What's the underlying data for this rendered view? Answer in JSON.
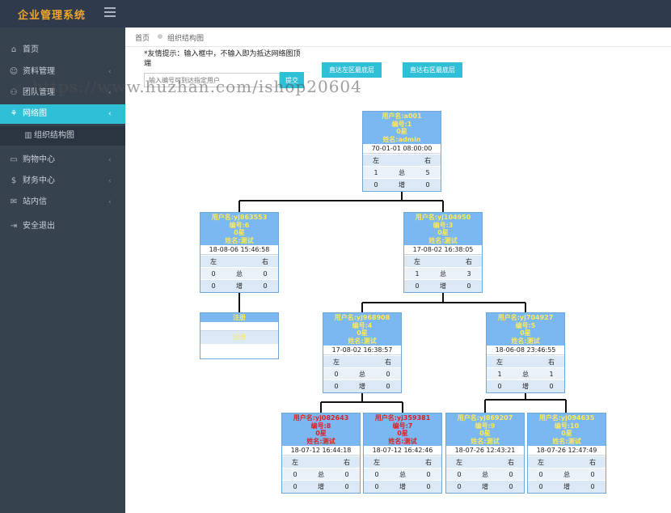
{
  "app": {
    "title": "企业管理系统"
  },
  "sidebar": {
    "items": [
      {
        "label": "首页",
        "icon": "home-icon",
        "glyph": "⌂",
        "arrow": ""
      },
      {
        "label": "资料管理",
        "icon": "user-icon",
        "glyph": "☺",
        "arrow": "‹"
      },
      {
        "label": "团队管理",
        "icon": "team-icon",
        "glyph": "⚇",
        "arrow": "‹"
      },
      {
        "label": "网络图",
        "icon": "sitemap-icon",
        "glyph": "⚘",
        "arrow": "‹"
      },
      {
        "label": "组织结构图",
        "icon": "bar-chart-icon",
        "glyph": "▥",
        "arrow": ""
      },
      {
        "label": "购物中心",
        "icon": "truck-icon",
        "glyph": "▭",
        "arrow": "‹"
      },
      {
        "label": "财务中心",
        "icon": "dollar-icon",
        "glyph": "$",
        "arrow": "‹"
      },
      {
        "label": "站内信",
        "icon": "envelope-icon",
        "glyph": "✉",
        "arrow": "‹"
      },
      {
        "label": "安全退出",
        "icon": "logout-icon",
        "glyph": "⇥",
        "arrow": ""
      }
    ]
  },
  "breadcrumb": {
    "home": "首页",
    "current": "组织结构图"
  },
  "search": {
    "tip": "*友情提示：输入框中，不输入即为抵达网络图顶端",
    "placeholder": "输入编号可到达指定用户",
    "submit_label": "提交",
    "jump_left_label": "直达左区最底层",
    "jump_right_label": "直达右区最底层"
  },
  "watermark": "https://www.huzhan.com/ishop20604",
  "tree": {
    "labels": {
      "left": "左",
      "right": "右",
      "total": "总",
      "new": "增"
    },
    "nodes": [
      {
        "id": "n0",
        "l1": "用户名:a001",
        "l2": "编号:1",
        "l3": "0星",
        "l4": "姓名:admin",
        "date": "70-01-01 08:00:00",
        "tl": "1",
        "tr": "5",
        "nl": "0",
        "nr": "0",
        "red": false
      },
      {
        "id": "n1",
        "l1": "用户名:yj863553",
        "l2": "编号:6",
        "l3": "0星",
        "l4": "姓名:测试",
        "date": "18-08-06 15:46:58",
        "tl": "0",
        "tr": "0",
        "nl": "0",
        "nr": "0",
        "red": false
      },
      {
        "id": "n2",
        "l1": "用户名:yj104950",
        "l2": "编号:3",
        "l3": "0星",
        "l4": "姓名:测试",
        "date": "17-08-02 16:38:05",
        "tl": "1",
        "tr": "3",
        "nl": "0",
        "nr": "0",
        "red": false
      },
      {
        "id": "n3",
        "l1": "用户名:yj968908",
        "l2": "编号:4",
        "l3": "0星",
        "l4": "姓名:测试",
        "date": "17-08-02 16:38:57",
        "tl": "0",
        "tr": "0",
        "nl": "0",
        "nr": "0",
        "red": false
      },
      {
        "id": "n4",
        "l1": "用户名:yj704927",
        "l2": "编号:5",
        "l3": "0星",
        "l4": "姓名:测试",
        "date": "18-06-08 23:46:55",
        "tl": "1",
        "tr": "1",
        "nl": "0",
        "nr": "0",
        "red": false
      },
      {
        "id": "n5",
        "l1": "用户名:yj082643",
        "l2": "编号:8",
        "l3": "0星",
        "l4": "姓名:测试",
        "date": "18-07-12 16:44:18",
        "tl": "0",
        "tr": "0",
        "nl": "0",
        "nr": "0",
        "red": true
      },
      {
        "id": "n6",
        "l1": "用户名:yj359381",
        "l2": "编号:7",
        "l3": "0星",
        "l4": "姓名:测试",
        "date": "18-07-12 16:42:46",
        "tl": "0",
        "tr": "0",
        "nl": "0",
        "nr": "0",
        "red": true
      },
      {
        "id": "n7",
        "l1": "用户名:yj869207",
        "l2": "编号:9",
        "l3": "0星",
        "l4": "姓名:测试",
        "date": "18-07-26 12:43:21",
        "tl": "0",
        "tr": "0",
        "nl": "0",
        "nr": "0",
        "red": false
      },
      {
        "id": "n8",
        "l1": "用户名:yj094635",
        "l2": "编号:10",
        "l3": "0星",
        "l4": "姓名:测试",
        "date": "18-07-26 12:47:49",
        "tl": "0",
        "tr": "0",
        "nl": "0",
        "nr": "0",
        "red": false
      }
    ],
    "register": {
      "title": "注册",
      "sub": "注册"
    }
  },
  "colors": {
    "accent": "#2fbfd6",
    "sidebar": "#37424f",
    "topbar": "#2f3b4c",
    "node_header": "#7bb7f0",
    "node_text": "#ffe85a",
    "node_text_alt": "#e02020"
  }
}
